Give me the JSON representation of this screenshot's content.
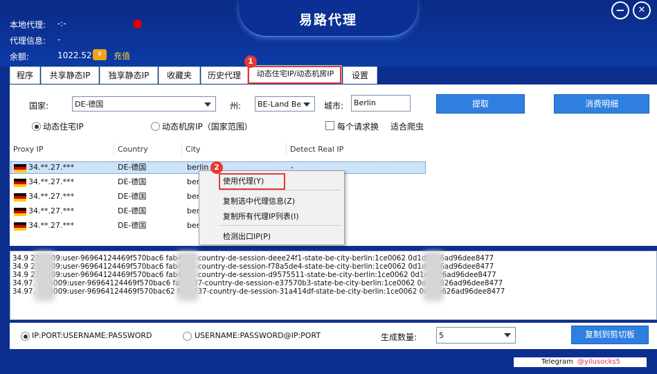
{
  "app": {
    "title": "易路代理"
  },
  "header": {
    "local_proxy_label": "本地代理:",
    "local_proxy_value": "-:-",
    "proxy_info_label": "代理信息:",
    "proxy_info_value": "-",
    "balance_label": "余额:",
    "balance_value": "1022.52",
    "coin_symbol": "¥",
    "recharge_label": "充值",
    "minimize_symbol": "−",
    "close_symbol": "✕"
  },
  "tabs": [
    "程序",
    "共享静态IP",
    "独享静态IP",
    "收藏夹",
    "历史代理",
    "动态住宅IP/动态机房IP",
    "设置"
  ],
  "active_tab": "动态住宅IP/动态机房IP",
  "annotations": {
    "step1": "1",
    "step2": "2"
  },
  "filters": {
    "country_label": "国家:",
    "country_value": "DE-德国",
    "state_label": "州:",
    "state_value": "BE-Land Be",
    "city_label": "城市:",
    "city_value": "Berlin",
    "extract_button": "提取",
    "spending_button": "消费明细",
    "residential_label": "动态住宅IP",
    "datacenter_label": "动态机房IP（国家范围）",
    "per_request_label": "每个请求换",
    "crawler_label": "适合爬虫"
  },
  "table": {
    "columns": [
      "Proxy IP",
      "Country",
      "City",
      "Detect Real IP"
    ],
    "rows": [
      {
        "ip": "34.**.27.***",
        "country": "DE-德国",
        "city": "berlin",
        "real_ip": "-"
      },
      {
        "ip": "34.**.27.***",
        "country": "DE-德国",
        "city": "berl"
      },
      {
        "ip": "34.**.27.***",
        "country": "DE-德国",
        "city": "berl"
      },
      {
        "ip": "34.**.27.***",
        "country": "DE-德国",
        "city": "berl"
      },
      {
        "ip": "34.**.27.***",
        "country": "DE-德国",
        "city": "berl"
      }
    ]
  },
  "context_menu": {
    "use_proxy": "使用代理(Y)",
    "copy_selected": "复制选中代理信息(Z)",
    "copy_all": "复制所有代理IP列表(I)",
    "detect_exit": "检测出口IP(P)"
  },
  "output_lines": [
    "34.9          23:5009:user-96964124469f570bac6          fab4237-country-de-session-deee24f1-state-be-city-berlin:1ce0062          0d1d6626ad96dee8477",
    "34.9          23:5009:user-96964124469f570bac6          fab4237-country-de-session-f78a5de4-state-be-city-berlin:1ce0062          0d1d6626ad96dee8477",
    "34.9          23:5009:user-96964124469f570bac6          fab4237-country-de-session-d9575511-state-be-city-berlin:1ce0062          0d1d6626ad96dee8477",
    "34.97.          23:5009:user-96964124469f570bac6          fab4237-country-de-session-e37570b3-state-be-city-berlin:1ce0062          0d1d6626ad96dee8477",
    "34.97.          23:5009:user-96964124469f570bac62         fab4237-country-de-session-31a414df-state-be-city-berlin:1ce0062          0d1d6626ad96dee8477"
  ],
  "format": {
    "option1": "IP:PORT:USERNAME:PASSWORD",
    "option2": "USERNAME:PASSWORD@IP:PORT",
    "count_label": "生成数量:",
    "count_value": "5",
    "copy_button": "复制到剪切板"
  },
  "footer": {
    "telegram_label": "Telegram",
    "telegram_handle": "@yilusocks5"
  },
  "colors": {
    "frame": "#0c2f8f",
    "accent_button": "#2f7fe0",
    "highlight": "#e53935",
    "recharge": "#ffd42a"
  }
}
